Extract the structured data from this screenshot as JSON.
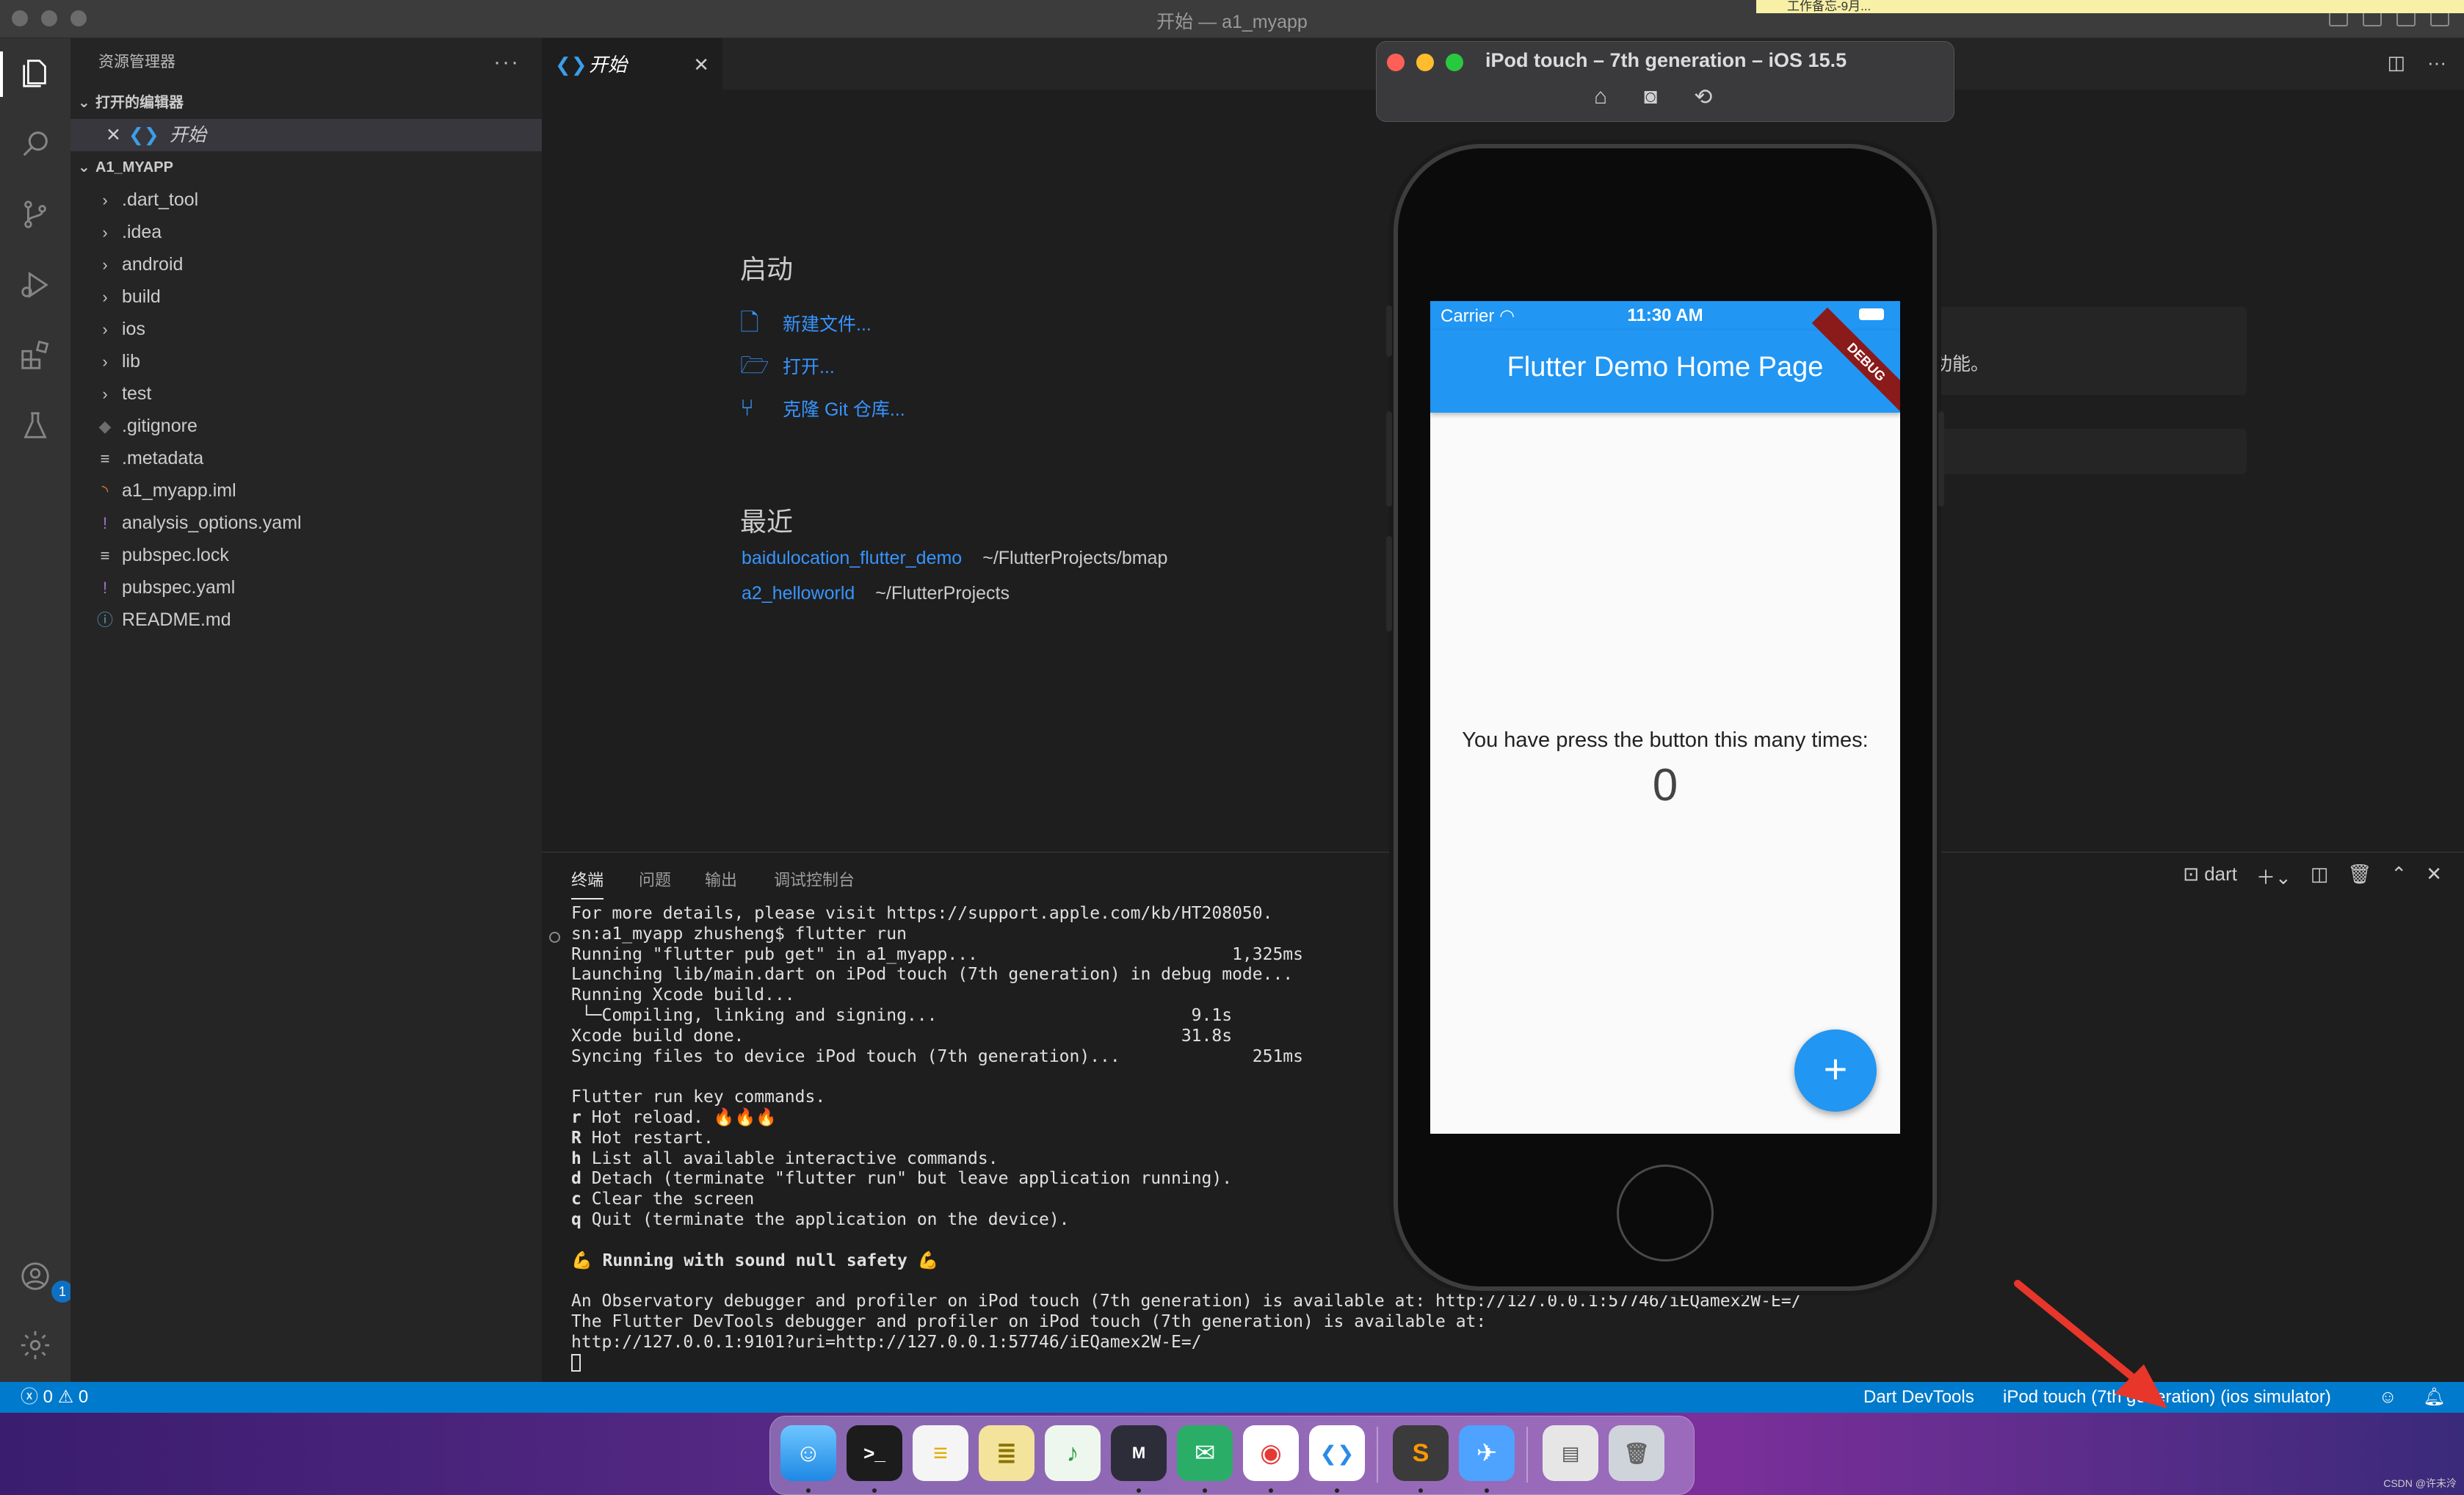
{
  "window": {
    "title": "开始 — a1_myapp",
    "sticky_note": "工作备忘-9月..."
  },
  "sidebar": {
    "header": "资源管理器",
    "more": "···",
    "open_editors_label": "打开的编辑器",
    "open_editor_item": "开始",
    "project_label": "A1_MYAPP",
    "items": [
      {
        "label": ".dart_tool",
        "icon": "chevron-right"
      },
      {
        "label": ".idea",
        "icon": "chevron-right"
      },
      {
        "label": "android",
        "icon": "chevron-right"
      },
      {
        "label": "build",
        "icon": "chevron-right"
      },
      {
        "label": "ios",
        "icon": "chevron-right"
      },
      {
        "label": "lib",
        "icon": "chevron-right"
      },
      {
        "label": "test",
        "icon": "chevron-right"
      },
      {
        "label": ".gitignore",
        "icon": "gitignore-file"
      },
      {
        "label": ".metadata",
        "icon": "text-file"
      },
      {
        "label": "a1_myapp.iml",
        "icon": "rss-file"
      },
      {
        "label": "analysis_options.yaml",
        "icon": "yaml-file"
      },
      {
        "label": "pubspec.lock",
        "icon": "text-file"
      },
      {
        "label": "pubspec.yaml",
        "icon": "yaml-file"
      },
      {
        "label": "README.md",
        "icon": "info-file"
      }
    ]
  },
  "activity": {
    "accounts_badge": "1"
  },
  "editor": {
    "tab_label": "开始",
    "start_heading": "启动",
    "start_links": [
      {
        "label": "新建文件...",
        "icon": "new-file-icon"
      },
      {
        "label": "打开...",
        "icon": "folder-open-icon"
      },
      {
        "label": "克隆 Git 仓库...",
        "icon": "git-branch-icon"
      }
    ],
    "recent_heading": "最近",
    "recent": [
      {
        "name": "baidulocation_flutter_demo",
        "path": "~/FlutterProjects/bmap"
      },
      {
        "name": "a2_helloworld",
        "path": "~/FlutterProjects"
      }
    ],
    "walkthrough_partial_text": "功能。"
  },
  "panel": {
    "tabs": [
      "终端",
      "问题",
      "输出",
      "调试控制台"
    ],
    "active_tab": "终端",
    "shell_label": "dart",
    "terminal_lines": [
      "For more details, please visit https://support.apple.com/kb/HT208050.",
      "sn:a1_myapp zhusheng$ flutter run",
      "Running \"flutter pub get\" in a1_myapp...                         1,325ms",
      "Launching lib/main.dart on iPod touch (7th generation) in debug mode...",
      "Running Xcode build...",
      " └─Compiling, linking and signing...                         9.1s",
      "Xcode build done.                                           31.8s",
      "Syncing files to device iPod touch (7th generation)...             251ms",
      "",
      "Flutter run key commands.",
      "r Hot reload. 🔥🔥🔥",
      "R Hot restart.",
      "h List all available interactive commands.",
      "d Detach (terminate \"flutter run\" but leave application running).",
      "c Clear the screen",
      "q Quit (terminate the application on the device).",
      "",
      "💪 Running with sound null safety 💪",
      "",
      "An Observatory debugger and profiler on iPod touch (7th generation) is available at: http://127.0.0.1:57746/iEQamex2W-E=/",
      "The Flutter DevTools debugger and profiler on iPod touch (7th generation) is available at:",
      "http://127.0.0.1:9101?uri=http://127.0.0.1:57746/iEQamex2W-E=/"
    ]
  },
  "statusbar": {
    "errors": "0",
    "warnings": "0",
    "devtools": "Dart DevTools",
    "device": "iPod touch (7th generation) (ios simulator)"
  },
  "simulator": {
    "title": "iPod touch – 7th generation – iOS 15.5",
    "carrier": "Carrier",
    "time": "11:30 AM",
    "debug_banner": "DEBUG",
    "app_title": "Flutter Demo Home Page",
    "counter_text": "You have press the button this many times:",
    "counter_value": "0",
    "fab_label": "+"
  },
  "watermark": "CSDN @许未泠",
  "colors": {
    "accent": "#007acc",
    "flutter_blue": "#2196f3",
    "link": "#3794ff"
  }
}
